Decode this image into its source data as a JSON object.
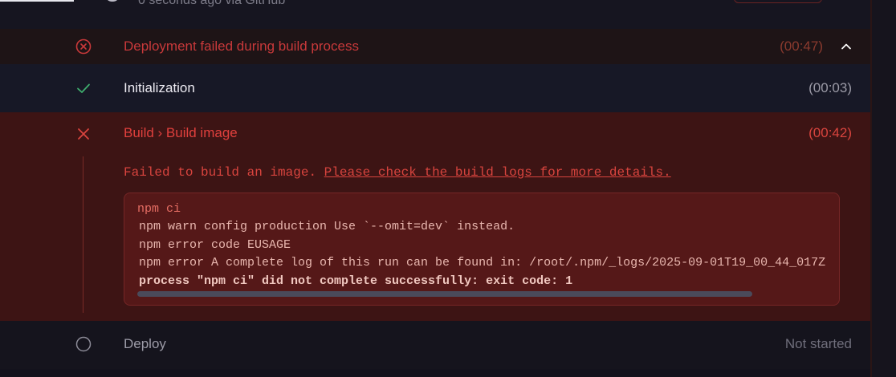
{
  "header": {
    "source_text": "0 seconds ago via GitHub"
  },
  "summary": {
    "title": "Deployment failed during build process",
    "duration": "(00:47)",
    "status_icon": "x-circle-icon",
    "toggle_icon": "chevron-up-icon"
  },
  "steps": [
    {
      "label": "Initialization",
      "duration": "(00:03)",
      "status": "success",
      "icon": "check-icon"
    },
    {
      "label": "Build › Build image",
      "duration": "(00:42)",
      "status": "failed",
      "icon": "x-icon",
      "error_text": "Failed to build an image.",
      "error_link": "Please check the build logs for more details.",
      "log": {
        "command": "npm ci",
        "lines": [
          "npm warn config production Use `--omit=dev` instead.",
          "npm error code EUSAGE",
          "npm error A complete log of this run can be found in: /root/.npm/_logs/2025-09-01T19_00_44_017Z"
        ],
        "result": "process \"npm ci\" did not complete successfully: exit code: 1"
      }
    },
    {
      "label": "Deploy",
      "duration": "Not started",
      "status": "pending",
      "icon": "circle-icon"
    }
  ],
  "colors": {
    "error": "#d8443e",
    "success": "#3fae6e",
    "background": "#13121c"
  }
}
